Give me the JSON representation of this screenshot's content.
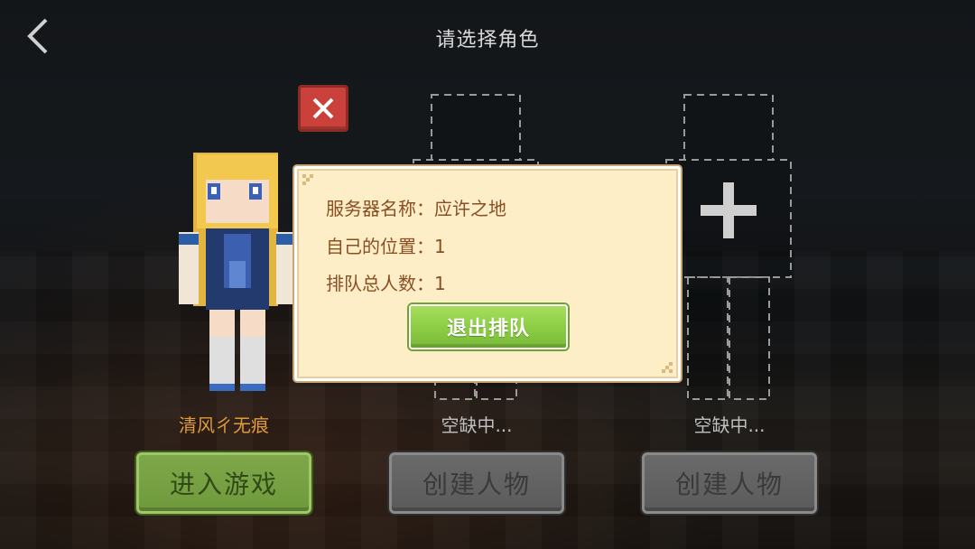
{
  "header": {
    "title": "请选择角色",
    "back_icon": "chevron-left-icon"
  },
  "slots": [
    {
      "name": "清风ㄔ无痕",
      "button_label": "进入游戏",
      "state": "occupied"
    },
    {
      "name": "空缺中...",
      "button_label": "创建人物",
      "state": "empty"
    },
    {
      "name": "空缺中...",
      "button_label": "创建人物",
      "state": "empty"
    }
  ],
  "delete_icon": "close-icon",
  "add_icon": "plus-icon",
  "dialog": {
    "server_label": "服务器名称：",
    "server_value": "应许之地",
    "position_label": "自己的位置：",
    "position_value": "1",
    "queue_label": "排队总人数：",
    "queue_value": "1",
    "quit_label": "退出排队"
  },
  "colors": {
    "enter_green": "#7ea74a",
    "dialog_bg": "#fdeec8",
    "dialog_text": "#8a4e22",
    "quit_green": "#8bcc43",
    "delete_red": "#c9413a",
    "name_orange": "#e09a3a"
  }
}
